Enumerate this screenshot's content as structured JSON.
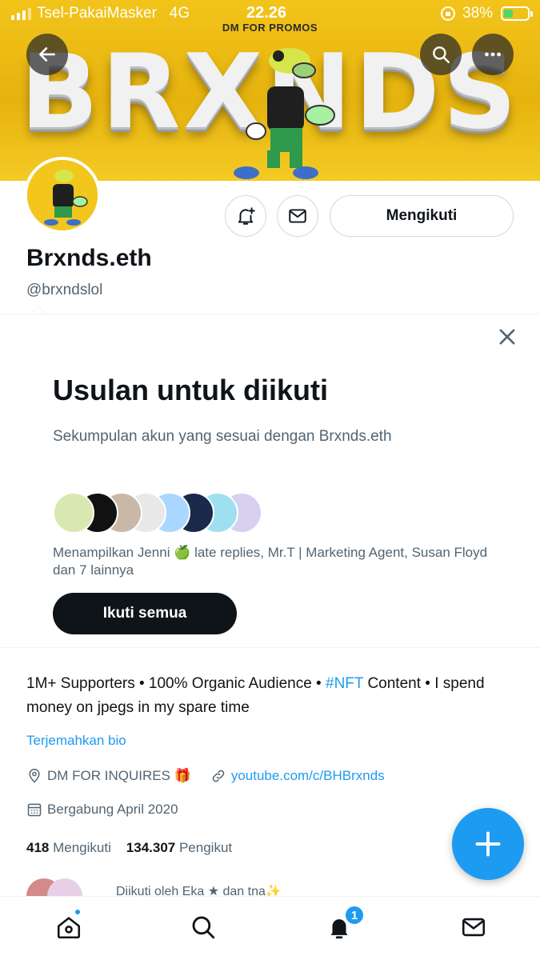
{
  "status_bar": {
    "carrier": "Tsel-PakaiMasker",
    "network": "4G",
    "time": "22.26",
    "battery": "38%",
    "battery_level": 0.38
  },
  "banner": {
    "subtitle": "DM FOR PROMOS",
    "wordmark": "BRXNDS",
    "background_color": "#f2c41a"
  },
  "nav": {
    "back_icon": "arrow-left-icon",
    "search_icon": "search-icon",
    "more_icon": "more-horizontal-icon"
  },
  "profile": {
    "display_name": "Brxnds.eth",
    "handle": "@brxndslol",
    "actions": {
      "notify_icon": "bell-plus-icon",
      "message_icon": "envelope-icon",
      "following_label": "Mengikuti"
    }
  },
  "suggestions": {
    "title": "Usulan untuk diikuti",
    "subtitle": "Sekumpulan akun yang sesuai dengan Brxnds.eth",
    "names_line": "Menampilkan Jenni 🍏 late replies, Mr.T | Marketing Agent, Susan Floyd dan 7 lainnya",
    "follow_all_label": "Ikuti semua",
    "avatar_colors": [
      "#d9e8b0",
      "#111111",
      "#c9b8a8",
      "#e8e8e8",
      "#a9d7ff",
      "#1a2a4a",
      "#9fe0f0",
      "#d8d0f0"
    ]
  },
  "bio": {
    "text_before": "1M+ Supporters • 100% Organic Audience • ",
    "hashtag": "#NFT",
    "text_after": " Content • I spend money on jpegs in my spare time",
    "translate_label": "Terjemahkan bio",
    "location": "DM FOR INQUIRES 🎁",
    "link": "youtube.com/c/BHBrxnds",
    "joined": "Bergabung April 2020"
  },
  "stats": {
    "following_count": "418",
    "following_label": "Mengikuti",
    "followers_count": "134.307",
    "followers_label": "Pengikut"
  },
  "followed_by": {
    "text": "Diikuti oleh Eka ★ dan tna✨"
  },
  "compose": {
    "icon": "plus-icon"
  },
  "tabbar": {
    "home_icon": "home-icon",
    "search_icon": "search-icon",
    "notifications_icon": "bell-icon",
    "notifications_badge": "1",
    "messages_icon": "envelope-icon"
  },
  "accent_color": "#1d9bf0"
}
